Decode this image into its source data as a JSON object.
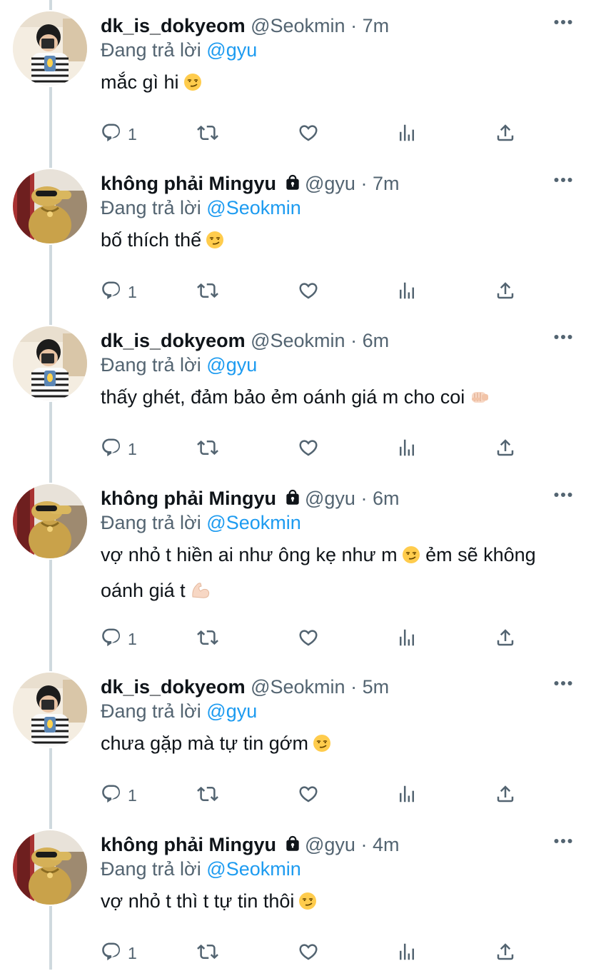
{
  "reply_prefix": "Đang trả lời",
  "colors": {
    "accent": "#1d9bf0",
    "muted": "#536471",
    "text": "#0f1419",
    "line": "#cfd9de"
  },
  "tweets": [
    {
      "name": "dk_is_dokyeom",
      "handle": "@Seokmin",
      "dot": "·",
      "time": "7m",
      "locked": false,
      "avatar": "dokyeom-avatar",
      "reply_to": "@gyu",
      "text": "mắc gì hi",
      "emoji": "smirk",
      "text2": "",
      "emoji2": "",
      "reply_count": "1"
    },
    {
      "name": "không phải Mingyu",
      "handle": "@gyu",
      "dot": "·",
      "time": "7m",
      "locked": true,
      "avatar": "mingyu-avatar",
      "reply_to": "@Seokmin",
      "text": "bố thích thế",
      "emoji": "smirk",
      "text2": "",
      "emoji2": "",
      "reply_count": "1"
    },
    {
      "name": "dk_is_dokyeom",
      "handle": "@Seokmin",
      "dot": "·",
      "time": "6m",
      "locked": false,
      "avatar": "dokyeom-avatar",
      "reply_to": "@gyu",
      "text": "thấy ghét, đảm bảo ẻm oánh giá m cho coi",
      "emoji": "fist",
      "text2": "",
      "emoji2": "",
      "reply_count": "1"
    },
    {
      "name": "không phải Mingyu",
      "handle": "@gyu",
      "dot": "·",
      "time": "6m",
      "locked": true,
      "avatar": "mingyu-avatar",
      "reply_to": "@Seokmin",
      "text": "vợ nhỏ t hiền ai như ông kẹ như m",
      "emoji": "smirk",
      "text_after": " ẻm sẽ không",
      "text2": "oánh giá t",
      "emoji2": "muscle",
      "reply_count": "1"
    },
    {
      "name": "dk_is_dokyeom",
      "handle": "@Seokmin",
      "dot": "·",
      "time": "5m",
      "locked": false,
      "avatar": "dokyeom-avatar",
      "reply_to": "@gyu",
      "text": "chưa gặp mà tự tin gớm",
      "emoji": "smirk",
      "text2": "",
      "emoji2": "",
      "reply_count": "1"
    },
    {
      "name": "không phải Mingyu",
      "handle": "@gyu",
      "dot": "·",
      "time": "4m",
      "locked": true,
      "avatar": "mingyu-avatar",
      "reply_to": "@Seokmin",
      "text": "vợ nhỏ t thì t tự tin thôi",
      "emoji": "smirk",
      "text2": "",
      "emoji2": "",
      "reply_count": "1"
    }
  ]
}
